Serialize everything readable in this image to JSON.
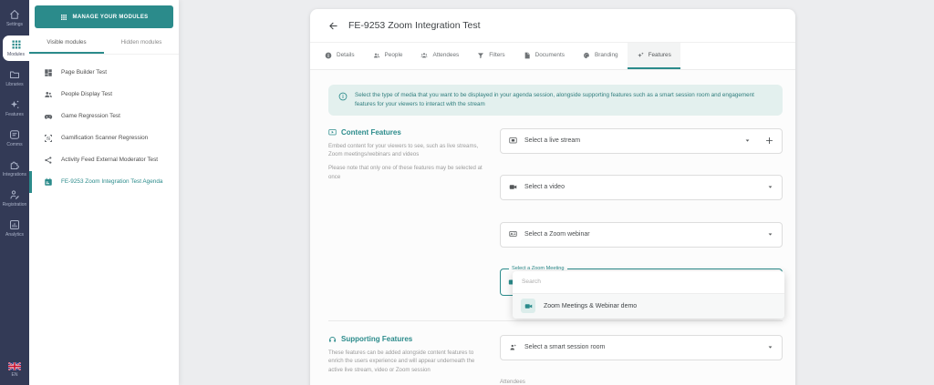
{
  "colors": {
    "accent": "#2b8b8b",
    "rail_bg": "#333a56",
    "banner_bg": "#e3f0ee",
    "banner_text": "#2f7d7d"
  },
  "rail": {
    "items": [
      {
        "label": "Settings",
        "icon": "home-icon"
      },
      {
        "label": "Modules",
        "icon": "grid-icon",
        "active": true
      },
      {
        "label": "Libraries",
        "icon": "folder-icon"
      },
      {
        "label": "Features",
        "icon": "sparkles-icon"
      },
      {
        "label": "Comms",
        "icon": "comms-icon"
      },
      {
        "label": "Integrations",
        "icon": "integrations-icon"
      },
      {
        "label": "Registration",
        "icon": "registration-icon"
      },
      {
        "label": "Analytics",
        "icon": "analytics-icon"
      }
    ],
    "language": "EN",
    "language_icon": "uk-flag-icon"
  },
  "sidebar": {
    "manage_button": "MANAGE YOUR MODULES",
    "tabs": [
      {
        "label": "Visible modules",
        "active": true
      },
      {
        "label": "Hidden modules",
        "active": false
      }
    ],
    "modules": [
      {
        "label": "Page Builder Test",
        "icon": "dashboard-icon"
      },
      {
        "label": "People Display Test",
        "icon": "people-icon"
      },
      {
        "label": "Game Regression Test",
        "icon": "gamepad-icon"
      },
      {
        "label": "Gamification Scanner Regression",
        "icon": "qr-scan-icon"
      },
      {
        "label": "Activity Feed External Moderator Test",
        "icon": "share-icon"
      },
      {
        "label": "FE-9253 Zoom Integration Test Agenda",
        "icon": "calendar-icon",
        "active": true
      }
    ]
  },
  "main": {
    "title": "FE-9253 Zoom Integration Test",
    "tabs": [
      {
        "label": "Details",
        "icon": "info-icon"
      },
      {
        "label": "People",
        "icon": "people-icon"
      },
      {
        "label": "Attendees",
        "icon": "attendees-icon"
      },
      {
        "label": "Filters",
        "icon": "filter-icon"
      },
      {
        "label": "Documents",
        "icon": "document-icon"
      },
      {
        "label": "Branding",
        "icon": "palette-icon"
      },
      {
        "label": "Features",
        "icon": "features-icon",
        "active": true
      }
    ],
    "banner": "Select the type of media that you want to be displayed in your agenda session, alongside supporting features such as a smart session room and engagement features for your viewers to interact with the stream",
    "content_features": {
      "title": "Content Features",
      "icon": "screen-play-icon",
      "description1": "Embed content for your viewers to see, such as live streams, Zoom meetings/webinars and videos",
      "description2": "Please note that only one of these features may be selected at once",
      "dropdowns": [
        {
          "label": "Select a live stream",
          "icon": "live-stream-icon",
          "has_add_button": true
        },
        {
          "label": "Select a video",
          "icon": "videocam-icon"
        },
        {
          "label": "Select a Zoom webinar",
          "icon": "webinar-icon"
        }
      ],
      "zoom_meeting": {
        "label": "Select a Zoom Meeting",
        "icon": "videocam-icon",
        "search_placeholder": "Search",
        "results": [
          {
            "label": "Zoom Meetings & Webinar demo",
            "icon": "videocam-icon"
          }
        ]
      }
    },
    "supporting_features": {
      "title": "Supporting Features",
      "icon": "headphones-icon",
      "description": "These features can be added alongside content features to enrich the users experience and will appear underneath the active live stream, video or Zoom session",
      "dropdown": {
        "label": "Select a smart session room",
        "icon": "smart-room-icon"
      },
      "next_section_partial_label": "Attendees"
    }
  }
}
